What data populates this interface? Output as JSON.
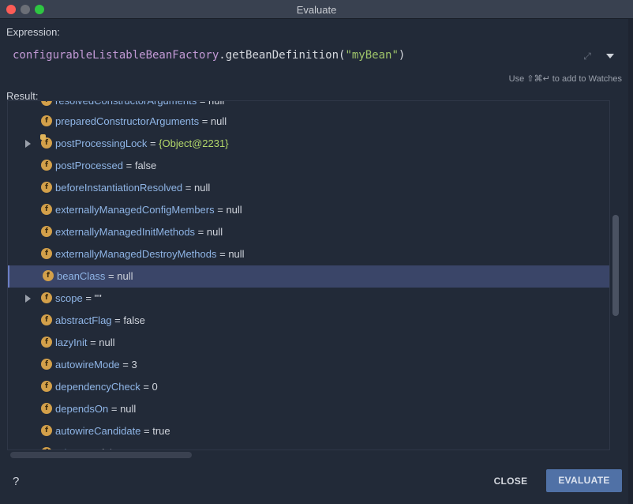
{
  "window": {
    "title": "Evaluate"
  },
  "expression": {
    "label": "Expression:",
    "identifier": "configurableListableBeanFactory",
    "method": ".getBeanDefinition(",
    "argument": "\"myBean\"",
    "close_paren": ")"
  },
  "hint": "Use ⇧⌘↵ to add to Watches",
  "result": {
    "label": "Result:",
    "partial_top": {
      "name": "resolvedConstructorArguments",
      "sep": " = ",
      "value": "null"
    },
    "rows": [
      {
        "name": "preparedConstructorArguments",
        "sep": " = ",
        "value": "null",
        "expandable": false,
        "selected": false,
        "lock": false
      },
      {
        "name": "postProcessingLock",
        "sep": " = ",
        "value": "{Object@2231}",
        "expandable": true,
        "selected": false,
        "lock": true,
        "object": true
      },
      {
        "name": "postProcessed",
        "sep": " = ",
        "value": "false",
        "expandable": false,
        "selected": false,
        "lock": false
      },
      {
        "name": "beforeInstantiationResolved",
        "sep": " = ",
        "value": "null",
        "expandable": false,
        "selected": false,
        "lock": false
      },
      {
        "name": "externallyManagedConfigMembers",
        "sep": " = ",
        "value": "null",
        "expandable": false,
        "selected": false,
        "lock": false
      },
      {
        "name": "externallyManagedInitMethods",
        "sep": " = ",
        "value": "null",
        "expandable": false,
        "selected": false,
        "lock": false
      },
      {
        "name": "externallyManagedDestroyMethods",
        "sep": " = ",
        "value": "null",
        "expandable": false,
        "selected": false,
        "lock": false
      },
      {
        "name": "beanClass",
        "sep": " = ",
        "value": "null",
        "expandable": false,
        "selected": true,
        "lock": false
      },
      {
        "name": "scope",
        "sep": " = ",
        "value": "\"\"",
        "expandable": true,
        "selected": false,
        "lock": false
      },
      {
        "name": "abstractFlag",
        "sep": " = ",
        "value": "false",
        "expandable": false,
        "selected": false,
        "lock": false
      },
      {
        "name": "lazyInit",
        "sep": " = ",
        "value": "null",
        "expandable": false,
        "selected": false,
        "lock": false
      },
      {
        "name": "autowireMode",
        "sep": " = ",
        "value": "3",
        "expandable": false,
        "selected": false,
        "lock": false
      },
      {
        "name": "dependencyCheck",
        "sep": " = ",
        "value": "0",
        "expandable": false,
        "selected": false,
        "lock": false
      },
      {
        "name": "dependsOn",
        "sep": " = ",
        "value": "null",
        "expandable": false,
        "selected": false,
        "lock": false
      },
      {
        "name": "autowireCandidate",
        "sep": " = ",
        "value": "true",
        "expandable": false,
        "selected": false,
        "lock": false
      }
    ],
    "partial_bottom": {
      "name": "primary",
      "sep": " = ",
      "value": "false"
    }
  },
  "field_icon_letter": "f",
  "icons": {
    "help": "?",
    "expand": "⤢"
  },
  "buttons": {
    "close": "CLOSE",
    "evaluate": "EVALUATE"
  },
  "colors": {
    "field_name": "#8fb5e6",
    "object_value": "#b4d86a",
    "selected_row": "#3a4568",
    "evaluate_button": "#5071a6"
  }
}
